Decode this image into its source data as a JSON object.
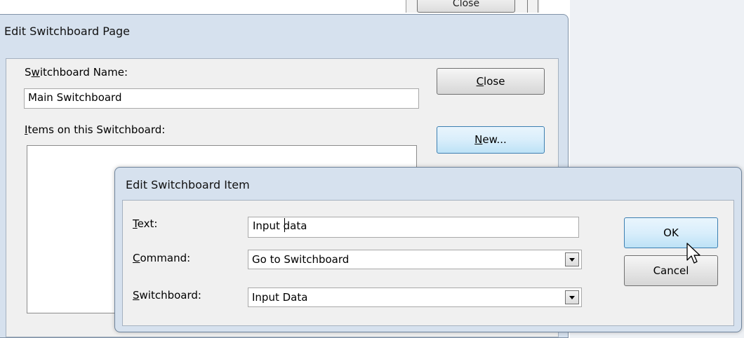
{
  "background": {
    "close_button_label": "Close"
  },
  "outer_dialog": {
    "title": "Edit Switchboard Page",
    "switchboard_name_label": {
      "prefix": "S",
      "mnemonic": "w",
      "suffix": "itchboard Name:"
    },
    "switchboard_name_value": "Main Switchboard",
    "items_label": {
      "prefix": "",
      "mnemonic": "I",
      "suffix": "tems on this Switchboard:"
    },
    "close_button": {
      "mnemonic": "C",
      "rest": "lose"
    },
    "new_button": {
      "mnemonic": "N",
      "rest": "ew..."
    }
  },
  "inner_dialog": {
    "title": "Edit Switchboard Item",
    "text_label": {
      "mnemonic": "T",
      "rest": "ext:"
    },
    "text_value": "Input data",
    "command_label": {
      "mnemonic": "C",
      "rest": "ommand:"
    },
    "command_value": "Go to Switchboard",
    "switchboard_label": {
      "mnemonic": "S",
      "rest": "witchboard:"
    },
    "switchboard_value": "Input Data",
    "ok_button": "OK",
    "cancel_button": "Cancel"
  },
  "icons": {
    "dropdown": "chevron-down-icon",
    "pointer": "mouse-pointer-icon",
    "text_cursor": "text-cursor-icon"
  }
}
